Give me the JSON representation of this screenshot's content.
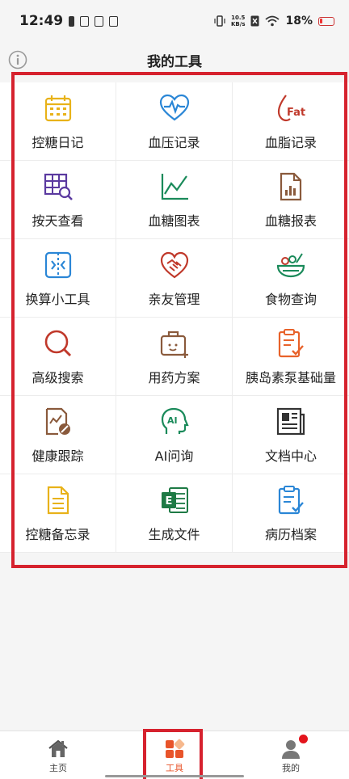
{
  "status_bar": {
    "time": "12:49",
    "speed_value": "10.5",
    "speed_unit": "KB/s",
    "battery": "18%"
  },
  "header": {
    "title": "我的工具"
  },
  "tools": [
    {
      "label": "控糖日记",
      "icon": "calendar-icon",
      "color": "#e8b219"
    },
    {
      "label": "血压记录",
      "icon": "heart-pulse-icon",
      "color": "#2a86d6"
    },
    {
      "label": "血脂记录",
      "icon": "fat-drop-icon",
      "color": "#c0392b"
    },
    {
      "label": "按天查看",
      "icon": "grid-search-icon",
      "color": "#5b3aa0"
    },
    {
      "label": "血糖图表",
      "icon": "line-chart-icon",
      "color": "#1a8a5a"
    },
    {
      "label": "血糖报表",
      "icon": "report-doc-icon",
      "color": "#8a5a3c"
    },
    {
      "label": "换算小工具",
      "icon": "convert-icon",
      "color": "#2a86d6"
    },
    {
      "label": "亲友管理",
      "icon": "handshake-heart-icon",
      "color": "#c0392b"
    },
    {
      "label": "食物查询",
      "icon": "food-bowl-icon",
      "color": "#1a8a5a"
    },
    {
      "label": "高级搜索",
      "icon": "search-icon",
      "color": "#c0392b"
    },
    {
      "label": "用药方案",
      "icon": "medical-kit-icon",
      "color": "#8a5a3c"
    },
    {
      "label": "胰岛素泵基础量",
      "icon": "clipboard-check-icon",
      "color": "#e8622a"
    },
    {
      "label": "健康跟踪",
      "icon": "health-track-icon",
      "color": "#8a5a3c"
    },
    {
      "label": "AI问询",
      "icon": "ai-head-icon",
      "color": "#1a8a5a"
    },
    {
      "label": "文档中心",
      "icon": "newspaper-icon",
      "color": "#333333"
    },
    {
      "label": "控糖备忘录",
      "icon": "memo-icon",
      "color": "#e8b219"
    },
    {
      "label": "生成文件",
      "icon": "excel-icon",
      "color": "#1e7a45"
    },
    {
      "label": "病历档案",
      "icon": "medical-record-icon",
      "color": "#2a86d6"
    }
  ],
  "bottom_nav": [
    {
      "label": "主页",
      "icon": "home-icon"
    },
    {
      "label": "工具",
      "icon": "tools-icon",
      "active": true
    },
    {
      "label": "我的",
      "icon": "profile-icon"
    }
  ],
  "info_icon": "info-icon",
  "accent_color": "#e8542a",
  "highlight_color": "#d6222e"
}
